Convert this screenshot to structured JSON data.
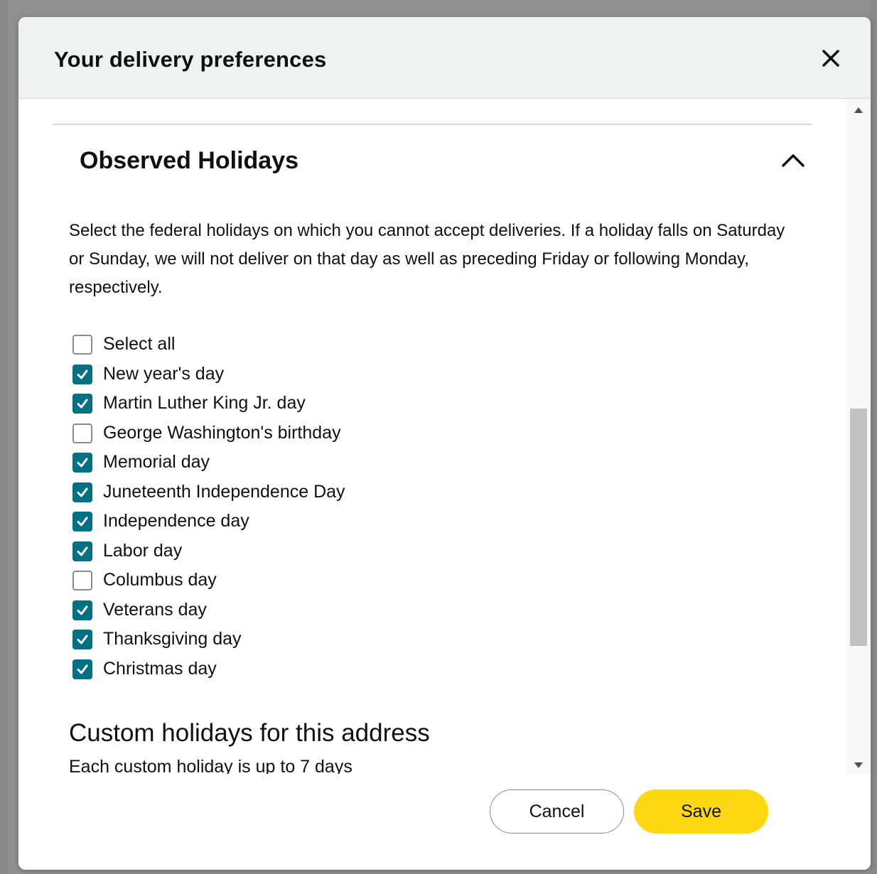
{
  "modal": {
    "title": "Your delivery preferences",
    "close_icon": "close-icon"
  },
  "observed_holidays": {
    "title": "Observed Holidays",
    "expanded": true,
    "description": "Select the federal holidays on which you cannot accept deliveries. If a holiday falls on Saturday or Sunday, we will not deliver on that day as well as preceding Friday or following Monday, respectively.",
    "items": [
      {
        "label": "Select all",
        "checked": false
      },
      {
        "label": "New year's day",
        "checked": true
      },
      {
        "label": "Martin Luther King Jr. day",
        "checked": true
      },
      {
        "label": "George Washington's birthday",
        "checked": false
      },
      {
        "label": "Memorial day",
        "checked": true
      },
      {
        "label": "Juneteenth Independence Day",
        "checked": true
      },
      {
        "label": "Independence day",
        "checked": true
      },
      {
        "label": "Labor day",
        "checked": true
      },
      {
        "label": "Columbus day",
        "checked": false
      },
      {
        "label": "Veterans day",
        "checked": true
      },
      {
        "label": "Thanksgiving day",
        "checked": true
      },
      {
        "label": "Christmas day",
        "checked": true
      }
    ]
  },
  "custom_holidays": {
    "title": "Custom holidays for this address",
    "subtitle": "Each custom holiday is up to 7 days"
  },
  "footer": {
    "cancel_label": "Cancel",
    "save_label": "Save"
  },
  "colors": {
    "checkbox_checked": "#007185",
    "save_button": "#ffd814",
    "header_bg": "#f0f2f2"
  }
}
